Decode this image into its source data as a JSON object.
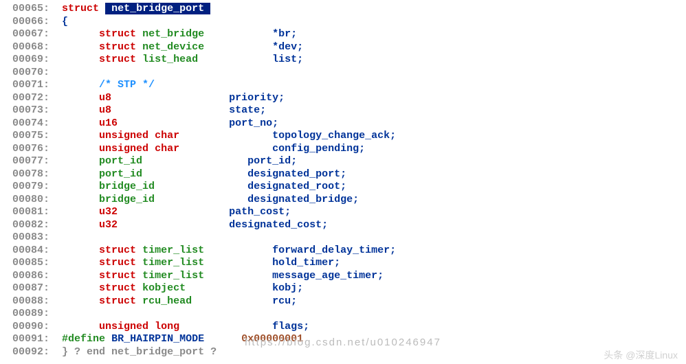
{
  "lines": [
    {
      "num": "00065:",
      "tokens": [
        {
          "cls": "kw",
          "text": "struct"
        },
        {
          "cls": null,
          "text": " "
        },
        {
          "cls": "hl",
          "text": " net_bridge_port "
        }
      ],
      "indent": "  "
    },
    {
      "num": "00066:",
      "tokens": [
        {
          "cls": "punct",
          "text": "{"
        }
      ],
      "indent": "  "
    },
    {
      "num": "00067:",
      "tokens": [
        {
          "cls": "kw",
          "text": "struct"
        },
        {
          "cls": null,
          "text": " "
        },
        {
          "cls": "type",
          "text": "net_bridge"
        },
        {
          "cls": null,
          "text": "           "
        },
        {
          "cls": "star",
          "text": "*"
        },
        {
          "cls": "ident",
          "text": "br"
        },
        {
          "cls": "punct",
          "text": ";"
        }
      ],
      "indent": "        "
    },
    {
      "num": "00068:",
      "tokens": [
        {
          "cls": "kw",
          "text": "struct"
        },
        {
          "cls": null,
          "text": " "
        },
        {
          "cls": "type",
          "text": "net_device"
        },
        {
          "cls": null,
          "text": "           "
        },
        {
          "cls": "star",
          "text": "*"
        },
        {
          "cls": "ident",
          "text": "dev"
        },
        {
          "cls": "punct",
          "text": ";"
        }
      ],
      "indent": "        "
    },
    {
      "num": "00069:",
      "tokens": [
        {
          "cls": "kw",
          "text": "struct"
        },
        {
          "cls": null,
          "text": " "
        },
        {
          "cls": "type",
          "text": "list_head"
        },
        {
          "cls": null,
          "text": "            "
        },
        {
          "cls": "ident",
          "text": "list"
        },
        {
          "cls": "punct",
          "text": ";"
        }
      ],
      "indent": "        "
    },
    {
      "num": "00070:",
      "tokens": [],
      "indent": ""
    },
    {
      "num": "00071:",
      "tokens": [
        {
          "cls": "cmt",
          "text": "/* STP */"
        }
      ],
      "indent": "        "
    },
    {
      "num": "00072:",
      "tokens": [
        {
          "cls": "kw",
          "text": "u8"
        },
        {
          "cls": null,
          "text": "                   "
        },
        {
          "cls": "ident",
          "text": "priority"
        },
        {
          "cls": "punct",
          "text": ";"
        }
      ],
      "indent": "        "
    },
    {
      "num": "00073:",
      "tokens": [
        {
          "cls": "kw",
          "text": "u8"
        },
        {
          "cls": null,
          "text": "                   "
        },
        {
          "cls": "ident",
          "text": "state"
        },
        {
          "cls": "punct",
          "text": ";"
        }
      ],
      "indent": "        "
    },
    {
      "num": "00074:",
      "tokens": [
        {
          "cls": "kw",
          "text": "u16"
        },
        {
          "cls": null,
          "text": "                  "
        },
        {
          "cls": "ident",
          "text": "port_no"
        },
        {
          "cls": "punct",
          "text": ";"
        }
      ],
      "indent": "        "
    },
    {
      "num": "00075:",
      "tokens": [
        {
          "cls": "kw",
          "text": "unsigned"
        },
        {
          "cls": null,
          "text": " "
        },
        {
          "cls": "kw",
          "text": "char"
        },
        {
          "cls": null,
          "text": "               "
        },
        {
          "cls": "ident",
          "text": "topology_change_ack"
        },
        {
          "cls": "punct",
          "text": ";"
        }
      ],
      "indent": "        "
    },
    {
      "num": "00076:",
      "tokens": [
        {
          "cls": "kw",
          "text": "unsigned"
        },
        {
          "cls": null,
          "text": " "
        },
        {
          "cls": "kw",
          "text": "char"
        },
        {
          "cls": null,
          "text": "               "
        },
        {
          "cls": "ident",
          "text": "config_pending"
        },
        {
          "cls": "punct",
          "text": ";"
        }
      ],
      "indent": "        "
    },
    {
      "num": "00077:",
      "tokens": [
        {
          "cls": "type",
          "text": "port_id"
        },
        {
          "cls": null,
          "text": "                 "
        },
        {
          "cls": "ident",
          "text": "port_id"
        },
        {
          "cls": "punct",
          "text": ";"
        }
      ],
      "indent": "        "
    },
    {
      "num": "00078:",
      "tokens": [
        {
          "cls": "type",
          "text": "port_id"
        },
        {
          "cls": null,
          "text": "                 "
        },
        {
          "cls": "ident",
          "text": "designated_port"
        },
        {
          "cls": "punct",
          "text": ";"
        }
      ],
      "indent": "        "
    },
    {
      "num": "00079:",
      "tokens": [
        {
          "cls": "type",
          "text": "bridge_id"
        },
        {
          "cls": null,
          "text": "               "
        },
        {
          "cls": "ident",
          "text": "designated_root"
        },
        {
          "cls": "punct",
          "text": ";"
        }
      ],
      "indent": "        "
    },
    {
      "num": "00080:",
      "tokens": [
        {
          "cls": "type",
          "text": "bridge_id"
        },
        {
          "cls": null,
          "text": "               "
        },
        {
          "cls": "ident",
          "text": "designated_bridge"
        },
        {
          "cls": "punct",
          "text": ";"
        }
      ],
      "indent": "        "
    },
    {
      "num": "00081:",
      "tokens": [
        {
          "cls": "kw",
          "text": "u32"
        },
        {
          "cls": null,
          "text": "                  "
        },
        {
          "cls": "ident",
          "text": "path_cost"
        },
        {
          "cls": "punct",
          "text": ";"
        }
      ],
      "indent": "        "
    },
    {
      "num": "00082:",
      "tokens": [
        {
          "cls": "kw",
          "text": "u32"
        },
        {
          "cls": null,
          "text": "                  "
        },
        {
          "cls": "ident",
          "text": "designated_cost"
        },
        {
          "cls": "punct",
          "text": ";"
        }
      ],
      "indent": "        "
    },
    {
      "num": "00083:",
      "tokens": [],
      "indent": ""
    },
    {
      "num": "00084:",
      "tokens": [
        {
          "cls": "kw",
          "text": "struct"
        },
        {
          "cls": null,
          "text": " "
        },
        {
          "cls": "type",
          "text": "timer_list"
        },
        {
          "cls": null,
          "text": "           "
        },
        {
          "cls": "ident",
          "text": "forward_delay_timer"
        },
        {
          "cls": "punct",
          "text": ";"
        }
      ],
      "indent": "        "
    },
    {
      "num": "00085:",
      "tokens": [
        {
          "cls": "kw",
          "text": "struct"
        },
        {
          "cls": null,
          "text": " "
        },
        {
          "cls": "type",
          "text": "timer_list"
        },
        {
          "cls": null,
          "text": "           "
        },
        {
          "cls": "ident",
          "text": "hold_timer"
        },
        {
          "cls": "punct",
          "text": ";"
        }
      ],
      "indent": "        "
    },
    {
      "num": "00086:",
      "tokens": [
        {
          "cls": "kw",
          "text": "struct"
        },
        {
          "cls": null,
          "text": " "
        },
        {
          "cls": "type",
          "text": "timer_list"
        },
        {
          "cls": null,
          "text": "           "
        },
        {
          "cls": "ident",
          "text": "message_age_timer"
        },
        {
          "cls": "punct",
          "text": ";"
        }
      ],
      "indent": "        "
    },
    {
      "num": "00087:",
      "tokens": [
        {
          "cls": "kw",
          "text": "struct"
        },
        {
          "cls": null,
          "text": " "
        },
        {
          "cls": "type",
          "text": "kobject"
        },
        {
          "cls": null,
          "text": "              "
        },
        {
          "cls": "ident",
          "text": "kobj"
        },
        {
          "cls": "punct",
          "text": ";"
        }
      ],
      "indent": "        "
    },
    {
      "num": "00088:",
      "tokens": [
        {
          "cls": "kw",
          "text": "struct"
        },
        {
          "cls": null,
          "text": " "
        },
        {
          "cls": "type",
          "text": "rcu_head"
        },
        {
          "cls": null,
          "text": "             "
        },
        {
          "cls": "ident",
          "text": "rcu"
        },
        {
          "cls": "punct",
          "text": ";"
        }
      ],
      "indent": "        "
    },
    {
      "num": "00089:",
      "tokens": [],
      "indent": ""
    },
    {
      "num": "00090:",
      "tokens": [
        {
          "cls": "kw",
          "text": "unsigned"
        },
        {
          "cls": null,
          "text": " "
        },
        {
          "cls": "kw",
          "text": "long"
        },
        {
          "cls": null,
          "text": "               "
        },
        {
          "cls": "ident",
          "text": "flags"
        },
        {
          "cls": "punct",
          "text": ";"
        }
      ],
      "indent": "        "
    },
    {
      "num": "00091:",
      "tokens": [
        {
          "cls": "def",
          "text": "#define"
        },
        {
          "cls": null,
          "text": " "
        },
        {
          "cls": "ident",
          "text": "BR_HAIRPIN_MODE"
        },
        {
          "cls": null,
          "text": "      "
        },
        {
          "cls": "hex",
          "text": "0x00000001"
        }
      ],
      "indent": "  "
    },
    {
      "num": "00092:",
      "tokens": [
        {
          "cls": "lnum",
          "text": "} ? end net_bridge_port ?"
        }
      ],
      "indent": "  "
    }
  ],
  "watermark": "https://blog.csdn.net/u010246947",
  "signature": "头条 @深度Linux"
}
